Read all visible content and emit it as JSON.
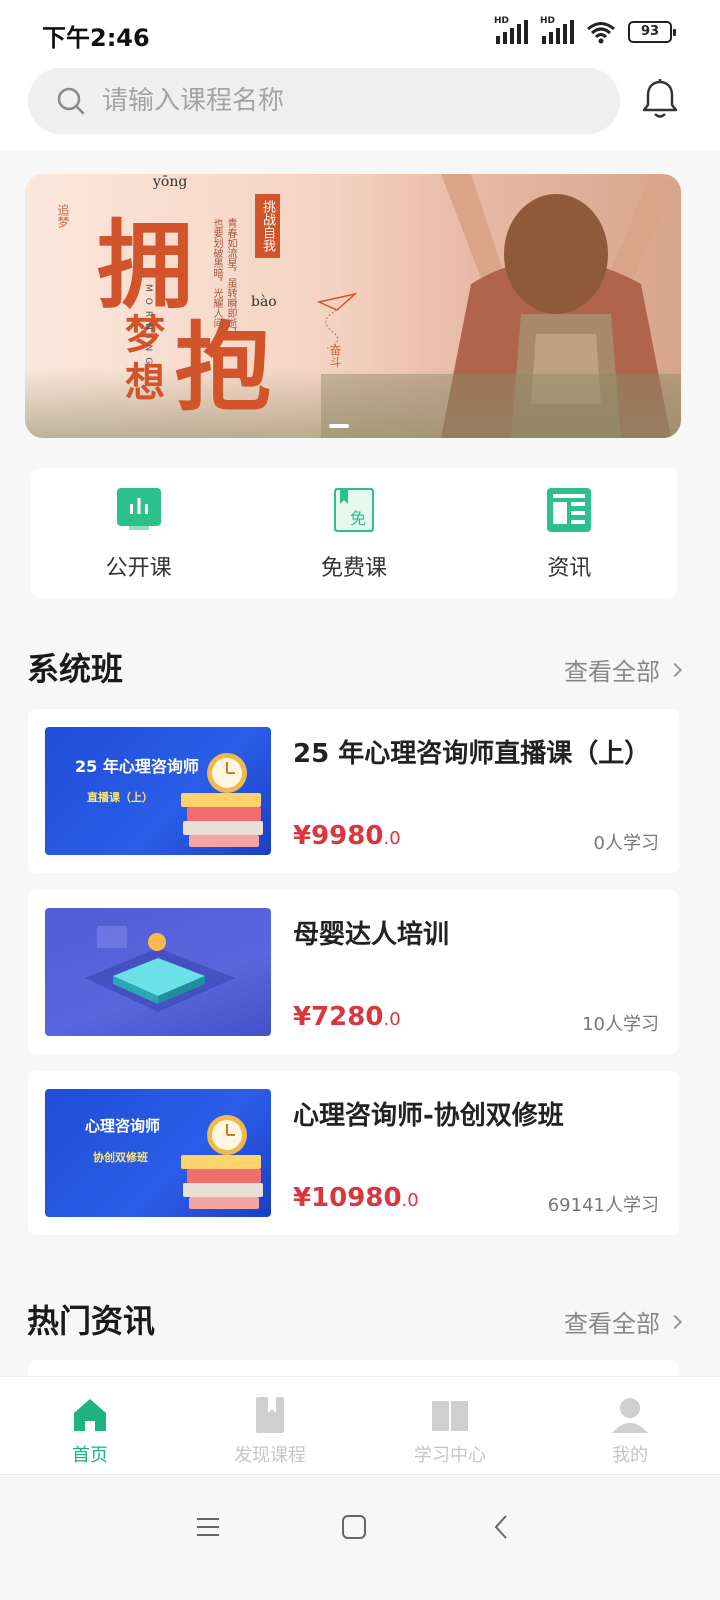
{
  "status_bar": {
    "time": "下午2:46",
    "battery": "93",
    "signal_label": "HD"
  },
  "search": {
    "placeholder": "请输入课程名称"
  },
  "banner": {
    "main_chars": [
      "拥",
      "梦",
      "想",
      "抱"
    ],
    "pinyin": [
      "yōng",
      "bào"
    ],
    "side_text_left": "追梦",
    "tag": "挑战自我",
    "side_text_right": "奋斗",
    "letters": "MORNING",
    "verse": "青春如流星，虽转瞬即逝，也要划破黑暗，光耀人间"
  },
  "quick_nav": [
    {
      "label": "公开课",
      "icon": "open-class-icon"
    },
    {
      "label": "免费课",
      "icon": "free-course-icon"
    },
    {
      "label": "资讯",
      "icon": "news-icon"
    }
  ],
  "system_class": {
    "title": "系统班",
    "more": "查看全部",
    "courses": [
      {
        "title": "25 年心理咨询师直播课（上）",
        "price": "¥9980",
        "price_decimal": ".0",
        "students": "0人学习",
        "thumb_title": "25 年心理咨询师",
        "thumb_sub": "直播课（上）"
      },
      {
        "title": "母婴达人培训",
        "price": "¥7280",
        "price_decimal": ".0",
        "students": "10人学习"
      },
      {
        "title": "心理咨询师-协创双修班",
        "price": "¥10980",
        "price_decimal": ".0",
        "students": "69141人学习",
        "thumb_title": "心理咨询师",
        "thumb_sub": "协创双修班"
      }
    ]
  },
  "hot_news": {
    "title": "热门资讯",
    "more": "查看全部"
  },
  "tab_bar": [
    {
      "label": "首页",
      "icon": "home-icon",
      "active": true
    },
    {
      "label": "发现课程",
      "icon": "bookmark-icon",
      "active": false
    },
    {
      "label": "学习中心",
      "icon": "open-book-icon",
      "active": false
    },
    {
      "label": "我的",
      "icon": "user-icon",
      "active": false
    }
  ],
  "colors": {
    "accent": "#1db27e",
    "price": "#d9363e",
    "banner_red": "#d2542b"
  }
}
